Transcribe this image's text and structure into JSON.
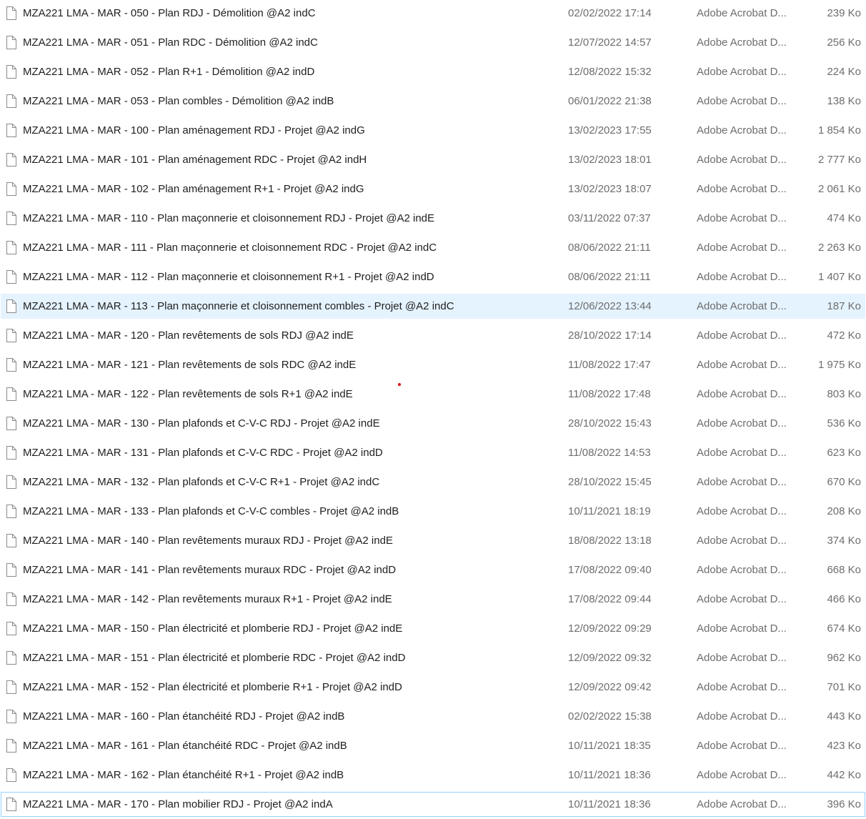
{
  "file_list": {
    "selected_index": 10,
    "focused_index": 27,
    "icon": "generic-file-icon",
    "files": [
      {
        "name": "MZA221 LMA - MAR - 050 - Plan RDJ - Démolition  @A2 indC",
        "date": "02/02/2022 17:14",
        "type": "Adobe Acrobat D...",
        "size": "239 Ko"
      },
      {
        "name": "MZA221 LMA - MAR - 051 - Plan RDC - Démolition  @A2 indC",
        "date": "12/07/2022 14:57",
        "type": "Adobe Acrobat D...",
        "size": "256 Ko"
      },
      {
        "name": "MZA221 LMA - MAR - 052 - Plan R+1 - Démolition  @A2 indD",
        "date": "12/08/2022 15:32",
        "type": "Adobe Acrobat D...",
        "size": "224 Ko"
      },
      {
        "name": "MZA221 LMA - MAR - 053 - Plan combles - Démolition  @A2 indB",
        "date": "06/01/2022 21:38",
        "type": "Adobe Acrobat D...",
        "size": "138 Ko"
      },
      {
        "name": "MZA221 LMA - MAR - 100 - Plan aménagement RDJ - Projet  @A2 indG",
        "date": "13/02/2023 17:55",
        "type": "Adobe Acrobat D...",
        "size": "1 854 Ko"
      },
      {
        "name": "MZA221 LMA - MAR - 101 - Plan aménagement RDC - Projet  @A2 indH",
        "date": "13/02/2023 18:01",
        "type": "Adobe Acrobat D...",
        "size": "2 777 Ko"
      },
      {
        "name": "MZA221 LMA - MAR - 102 - Plan aménagement R+1 - Projet  @A2 indG",
        "date": "13/02/2023 18:07",
        "type": "Adobe Acrobat D...",
        "size": "2 061 Ko"
      },
      {
        "name": "MZA221 LMA - MAR - 110 - Plan maçonnerie et cloisonnement RDJ - Projet  @A2 indE",
        "date": "03/11/2022 07:37",
        "type": "Adobe Acrobat D...",
        "size": "474 Ko"
      },
      {
        "name": "MZA221 LMA - MAR - 111 - Plan maçonnerie et cloisonnement RDC - Projet  @A2 indC",
        "date": "08/06/2022 21:11",
        "type": "Adobe Acrobat D...",
        "size": "2 263 Ko"
      },
      {
        "name": "MZA221 LMA - MAR - 112 - Plan maçonnerie et cloisonnement R+1 - Projet  @A2  indD",
        "date": "08/06/2022 21:11",
        "type": "Adobe Acrobat D...",
        "size": "1 407 Ko"
      },
      {
        "name": "MZA221 LMA - MAR - 113 - Plan maçonnerie et cloisonnement combles - Projet  @A2 indC",
        "date": "12/06/2022 13:44",
        "type": "Adobe Acrobat D...",
        "size": "187 Ko"
      },
      {
        "name": "MZA221 LMA - MAR - 120 - Plan revêtements de sols RDJ  @A2  indE",
        "date": "28/10/2022 17:14",
        "type": "Adobe Acrobat D...",
        "size": "472 Ko"
      },
      {
        "name": "MZA221 LMA - MAR - 121 - Plan revêtements de sols RDC  @A2 indE",
        "date": "11/08/2022 17:47",
        "type": "Adobe Acrobat D...",
        "size": "1 975 Ko"
      },
      {
        "name": "MZA221 LMA - MAR - 122 - Plan revêtements de sols R+1  @A2  indE",
        "date": "11/08/2022 17:48",
        "type": "Adobe Acrobat D...",
        "size": "803 Ko"
      },
      {
        "name": "MZA221 LMA - MAR - 130 - Plan plafonds et C-V-C RDJ - Projet  @A2  indE",
        "date": "28/10/2022 15:43",
        "type": "Adobe Acrobat D...",
        "size": "536 Ko"
      },
      {
        "name": "MZA221 LMA - MAR - 131 - Plan plafonds et C-V-C RDC - Projet  @A2  indD",
        "date": "11/08/2022 14:53",
        "type": "Adobe Acrobat D...",
        "size": "623 Ko"
      },
      {
        "name": "MZA221 LMA - MAR - 132 - Plan plafonds et C-V-C R+1 - Projet  @A2  indC",
        "date": "28/10/2022 15:45",
        "type": "Adobe Acrobat D...",
        "size": "670 Ko"
      },
      {
        "name": "MZA221 LMA - MAR - 133 - Plan plafonds et C-V-C combles - Projet  @A2 indB",
        "date": "10/11/2021 18:19",
        "type": "Adobe Acrobat D...",
        "size": "208 Ko"
      },
      {
        "name": "MZA221 LMA - MAR - 140 - Plan revêtements muraux RDJ - Projet  @A2  indE",
        "date": "18/08/2022 13:18",
        "type": "Adobe Acrobat D...",
        "size": "374 Ko"
      },
      {
        "name": "MZA221 LMA - MAR - 141 - Plan revêtements muraux RDC - Projet  @A2  indD",
        "date": "17/08/2022 09:40",
        "type": "Adobe Acrobat D...",
        "size": "668 Ko"
      },
      {
        "name": "MZA221 LMA - MAR - 142 - Plan revêtements muraux R+1 - Projet  @A2  indE",
        "date": "17/08/2022 09:44",
        "type": "Adobe Acrobat D...",
        "size": "466 Ko"
      },
      {
        "name": "MZA221 LMA - MAR - 150 - Plan électricité et plomberie RDJ - Projet  @A2  indE",
        "date": "12/09/2022 09:29",
        "type": "Adobe Acrobat D...",
        "size": "674 Ko"
      },
      {
        "name": "MZA221 LMA - MAR - 151 - Plan électricité et plomberie RDC - Projet  @A2  indD",
        "date": "12/09/2022 09:32",
        "type": "Adobe Acrobat D...",
        "size": "962 Ko"
      },
      {
        "name": "MZA221 LMA - MAR - 152 - Plan électricité et plomberie R+1 - Projet  @A2  indD",
        "date": "12/09/2022 09:42",
        "type": "Adobe Acrobat D...",
        "size": "701 Ko"
      },
      {
        "name": "MZA221 LMA - MAR - 160 - Plan étanchéité RDJ - Projet  @A2 indB",
        "date": "02/02/2022 15:38",
        "type": "Adobe Acrobat D...",
        "size": "443 Ko"
      },
      {
        "name": "MZA221 LMA - MAR - 161 - Plan étanchéité RDC - Projet  @A2 indB",
        "date": "10/11/2021 18:35",
        "type": "Adobe Acrobat D...",
        "size": "423 Ko"
      },
      {
        "name": "MZA221 LMA - MAR - 162 - Plan étanchéité R+1 - Projet  @A2  indB",
        "date": "10/11/2021 18:36",
        "type": "Adobe Acrobat D...",
        "size": "442 Ko"
      },
      {
        "name": "MZA221 LMA - MAR - 170 - Plan mobilier RDJ - Projet @A2 indA",
        "date": "10/11/2021 18:36",
        "type": "Adobe Acrobat D...",
        "size": "396 Ko"
      }
    ]
  },
  "colors": {
    "selected_background": "#e5f3ff",
    "focus_border": "#99d1ff",
    "secondary_text": "#6d6d6d",
    "marker": "#e01010"
  }
}
